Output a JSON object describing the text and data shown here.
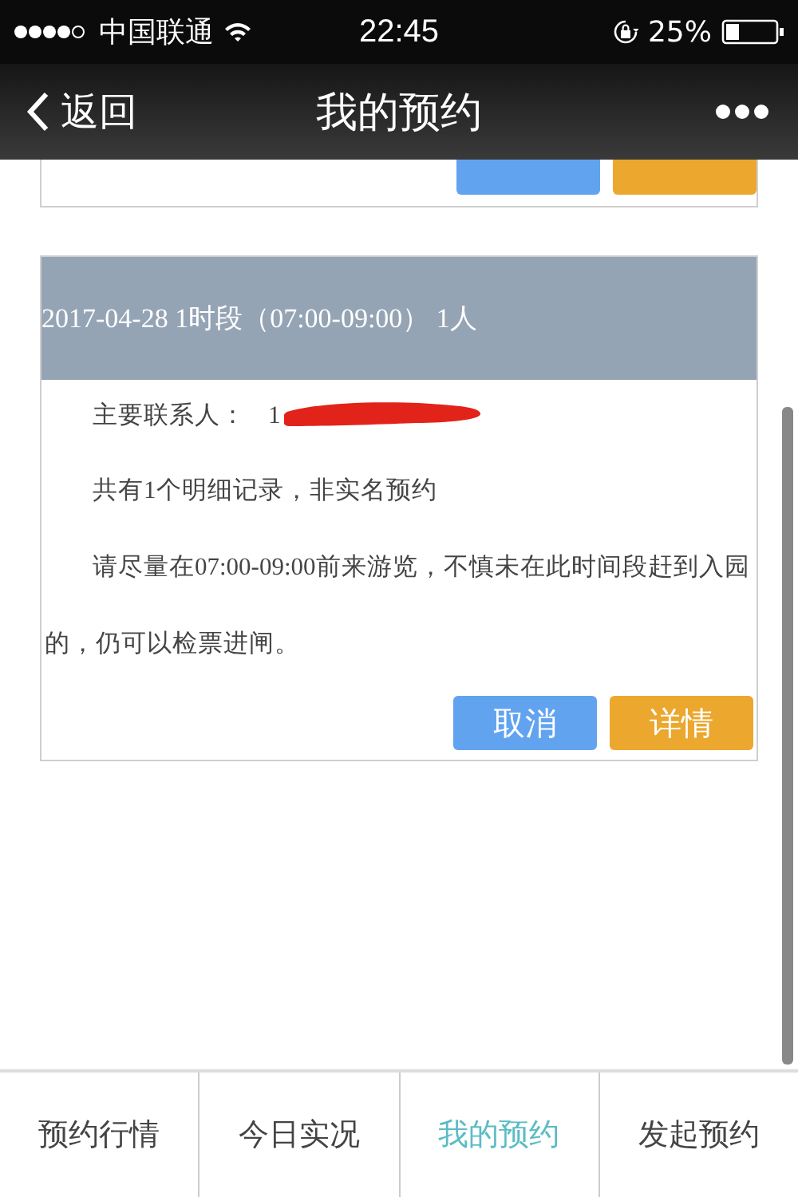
{
  "status_bar": {
    "carrier": "中国联通",
    "time": "22:45",
    "battery": "25%"
  },
  "nav": {
    "back": "返回",
    "title": "我的预约"
  },
  "reservations": [
    {
      "clipped": true,
      "buttons": [
        {
          "kind": "cancel"
        },
        {
          "kind": "details"
        }
      ]
    },
    {
      "clipped": false,
      "header": "2017-04-28 1时段（07:00-09:00） 1人",
      "contact_label": "主要联系人：",
      "contact_value": "1",
      "redacted": true,
      "summary": "共有1个明细记录，非实名预约",
      "notice": "请尽量在07:00-09:00前来游览，不慎未在此时间段赶到入园的，仍可以检票进闸。",
      "buttons": [
        {
          "label": "取消",
          "kind": "cancel"
        },
        {
          "label": "详情",
          "kind": "details"
        }
      ]
    }
  ],
  "tabs": [
    {
      "label": "预约行情",
      "selected": false
    },
    {
      "label": "今日实况",
      "selected": false
    },
    {
      "label": "我的预约",
      "selected": true
    },
    {
      "label": "发起预约",
      "selected": false
    }
  ]
}
